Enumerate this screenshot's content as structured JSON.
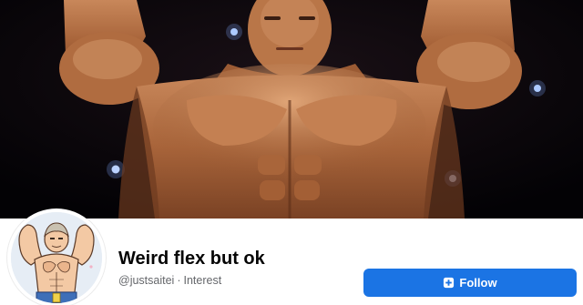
{
  "profile": {
    "name": "Weird flex but ok",
    "handle": "@justsaitei",
    "separator": "·",
    "category": "Interest"
  },
  "actions": {
    "follow_label": "Follow",
    "follow_icon": "follow-icon"
  },
  "cover_photo": {
    "icon": "cover-photo"
  },
  "avatar": {
    "icon": "profile-avatar"
  },
  "colors": {
    "accent": "#1b74e4",
    "title": "#050505",
    "secondary_text": "#65676b",
    "cover_background": "#050308"
  }
}
